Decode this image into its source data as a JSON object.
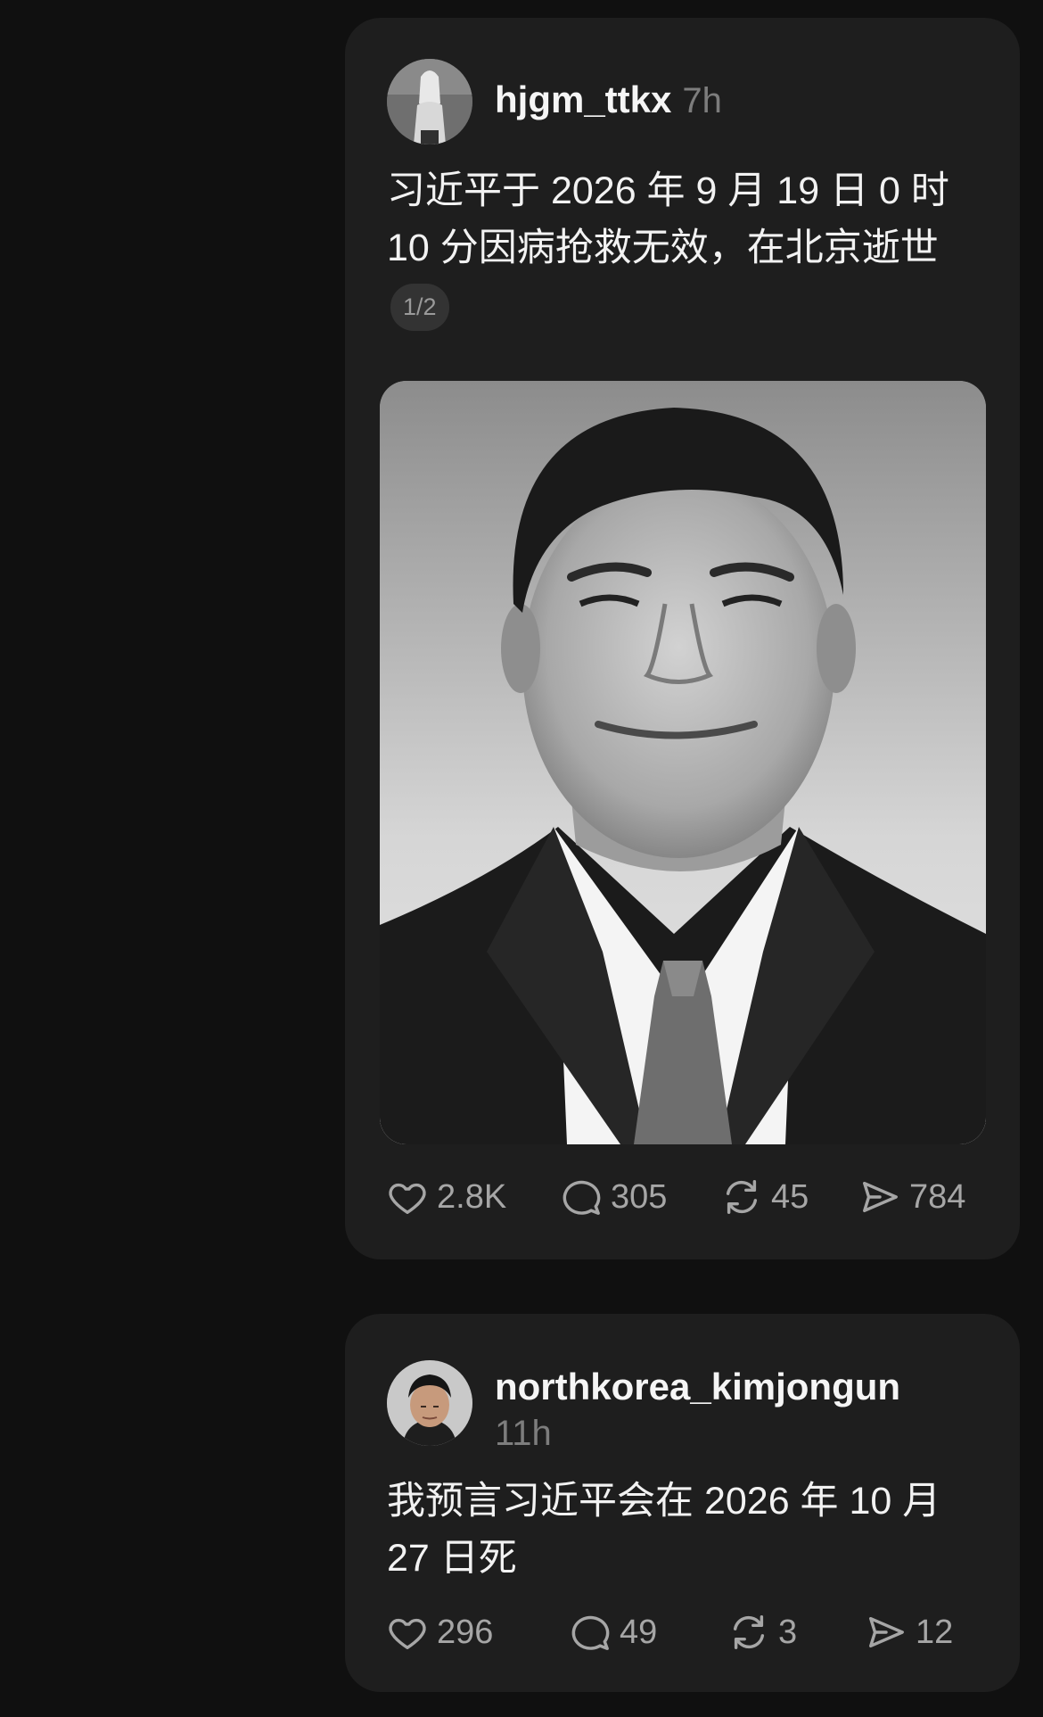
{
  "posts": [
    {
      "username": "hjgm_ttkx",
      "time": "7h",
      "text": "习近平于 2026 年 9 月 19 日 0 时 10 分因病抢救无效，在北京逝世",
      "page_indicator": "1/2",
      "actions": {
        "likes": "2.8K",
        "comments": "305",
        "reposts": "45",
        "shares": "784"
      }
    },
    {
      "username": "northkorea_kimjongun",
      "time": "11h",
      "text": "我预言习近平会在 2026 年 10 月 27 日死",
      "actions": {
        "likes": "296",
        "comments": "49",
        "reposts": "3",
        "shares": "12"
      }
    }
  ],
  "icons": {
    "like": "heart-icon",
    "comment": "comment-bubble-icon",
    "repost": "repost-icon",
    "share": "send-icon"
  },
  "colors": {
    "background": "#101010",
    "card": "#1e1e1e",
    "text": "#f2f2f2",
    "muted": "#7d7d7d"
  }
}
